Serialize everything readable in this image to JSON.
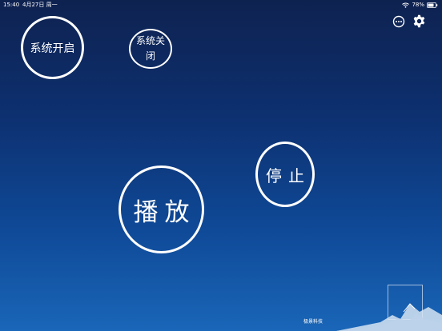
{
  "status_bar": {
    "time": "15:40",
    "date": "4月27日 周一",
    "battery_percent": "78%",
    "wifi_icon": "wifi-icon",
    "battery_icon": "battery-icon"
  },
  "toolbar": {
    "more_icon": "dots-circle-icon",
    "settings_icon": "gear-icon"
  },
  "buttons": {
    "system_on": "系统开启",
    "system_off": "系统关闭",
    "stop": "停止",
    "play": "播放"
  },
  "footer": {
    "brand": "极景科技"
  },
  "colors": {
    "background_top": "#0e2250",
    "background_bottom": "#1a66b8",
    "foreground": "#ffffff"
  }
}
